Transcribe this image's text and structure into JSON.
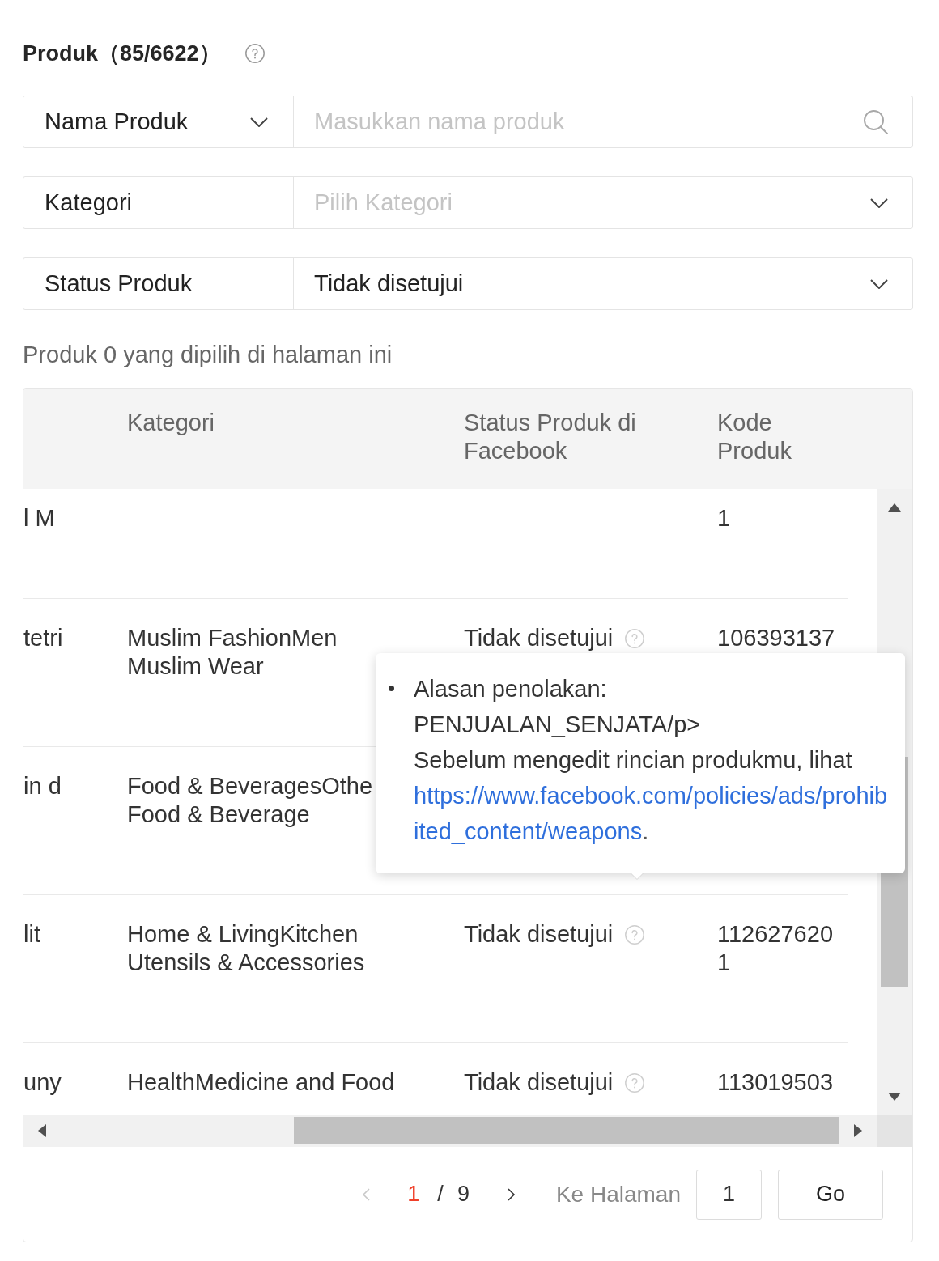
{
  "title": "Produk（85/6622）",
  "filters": [
    {
      "label": {
        "kind": "dropdown",
        "text": "Nama Produk"
      },
      "field": {
        "kind": "search",
        "placeholder": "Masukkan nama produk"
      }
    },
    {
      "label": {
        "kind": "static",
        "text": "Kategori"
      },
      "field": {
        "kind": "select",
        "placeholder": "Pilih Kategori"
      }
    },
    {
      "label": {
        "kind": "static",
        "text": "Status Produk"
      },
      "field": {
        "kind": "select",
        "value": "Tidak disetujui"
      }
    }
  ],
  "selection_note": "Produk 0 yang dipilih di halaman ini",
  "table": {
    "columns": [
      "Kategori",
      "Status Produk di Facebook",
      "Kode Produk"
    ],
    "rows": [
      {
        "column_1": "l M",
        "code": "1"
      },
      {
        "column_1": "tetri",
        "category": "Muslim FashionMen Muslim Wear",
        "status": "Tidak disetujui",
        "code": "106393137"
      },
      {
        "column_1": "in d",
        "category": "Food & BeveragesOthe Food & Beverage"
      },
      {
        "column_1": "lit",
        "category": "Home & LivingKitchen Utensils & Accessories",
        "status": "Tidak disetujui",
        "code": "1126276201"
      },
      {
        "column_1": "uny",
        "category": "HealthMedicine and Food",
        "status": "Tidak disetujui",
        "code": "113019503"
      }
    ],
    "tooltip": {
      "reason_label": "Alasan penolakan:",
      "reason": "PENJUALAN_SENJATA/p>",
      "note": "Sebelum mengedit rincian produkmu, lihat",
      "link": "https://www.facebook.com/policies/ads/prohibited_content/weapons",
      "note_end": "."
    }
  },
  "pagination": {
    "prev_disabled": true,
    "current": "1",
    "separator": "/",
    "total": "9",
    "next_disabled": false,
    "jump_label": "Ke Halaman",
    "jump_value": "1",
    "go_label": "Go"
  }
}
